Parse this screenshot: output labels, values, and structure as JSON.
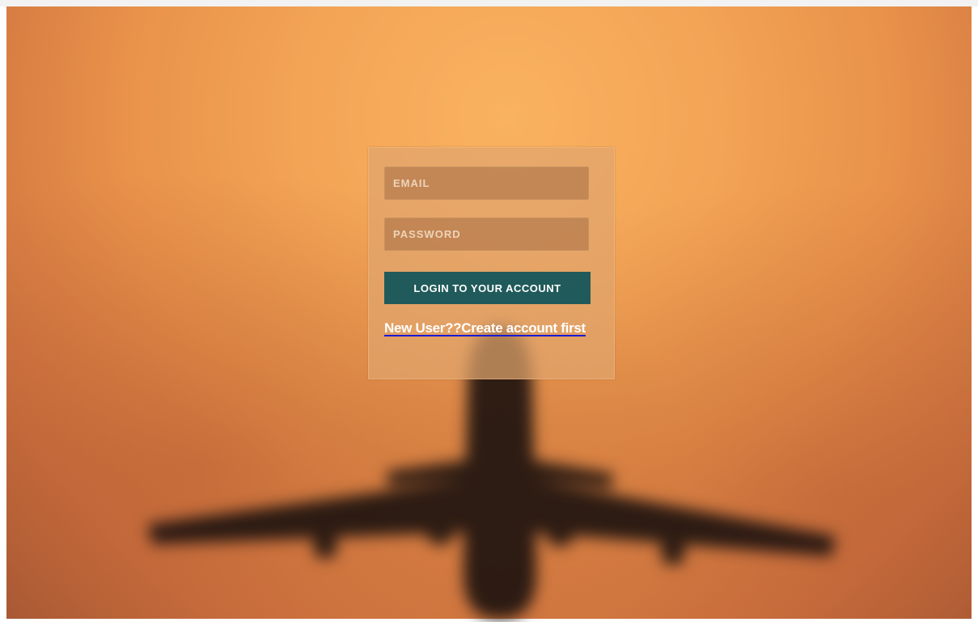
{
  "login_form": {
    "email_placeholder": "EMAIL",
    "password_placeholder": "PASSWORD",
    "submit_label": "LOGIN TO YOUR ACCOUNT",
    "signup_link_label": "New User??Create account first"
  },
  "theme": {
    "sky_light": "#f9b260",
    "sky_dark": "#a85a35",
    "button_color": "#215a5a",
    "link_underline_color": "#1a1ad0"
  },
  "icons": {
    "background": "airplane-silhouette-image"
  }
}
